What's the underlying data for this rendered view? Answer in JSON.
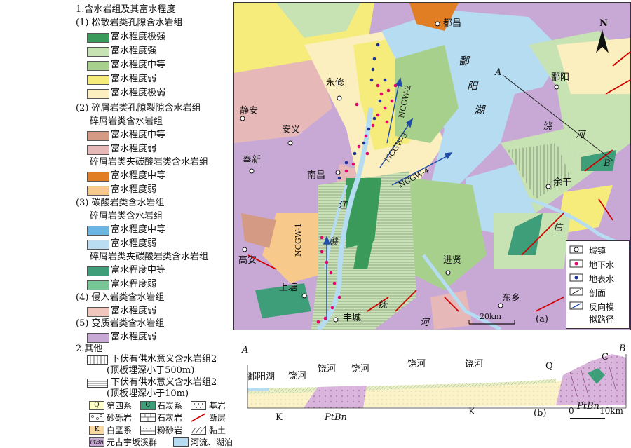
{
  "legend": {
    "h1": "1.含水岩组及其富水程度",
    "g1": "(1) 松散岩类孔隙含水岩组",
    "g1_items": [
      "富水程度极强",
      "富水程度强",
      "富水程度中等",
      "富水程度弱",
      "富水程度极弱"
    ],
    "g2": "(2) 碎屑岩类孔隙裂隙含水岩组",
    "g2a": "碎屑岩类含水岩组",
    "g2a_items": [
      "富水程度中等",
      "富水程度弱"
    ],
    "g2b": "碎屑岩类夹碳酸岩类含水岩组",
    "g2b_items": [
      "富水程度中等",
      "富水程度弱"
    ],
    "g3": "(3) 碳酸岩类含水岩组",
    "g3a": "碎屑岩类含水岩组",
    "g3a_items": [
      "富水程度中等",
      "富水程度弱"
    ],
    "g3b": "碎屑岩类夹碳酸岩类含水岩组",
    "g3b_items": [
      "富水程度中等",
      "富水程度弱"
    ],
    "g4": "(4) 侵入岩类含水岩组",
    "g4_items": [
      "富水程度弱"
    ],
    "g5": "(5) 变质岩类含水岩组",
    "g5_items": [
      "富水程度弱"
    ],
    "h2": "2.其他",
    "o1a": "下伏有供水意义含水岩组2",
    "o1b": "(顶板埋深小于500m)",
    "o2a": "下伏有供水意义含水岩组2",
    "o2b": "(顶板埋深小于10m)",
    "row1": {
      "q_sym": "Q",
      "q": "第四系",
      "c_sym": "C",
      "c": "石炭系",
      "bedrock": "基岩"
    },
    "row2": {
      "a": "砂砾岩",
      "b": "石灰岩",
      "c": "断层"
    },
    "row3": {
      "k_sym": "K",
      "k": "白垩系",
      "b": "粉砂岩",
      "c": "黏土"
    },
    "row4": {
      "pt_sym": "PtBn",
      "pt": "元古宇坂溪群",
      "river": "河流、湖泊"
    }
  },
  "colors": {
    "v_strong": "#3a9a5a",
    "strong": "#c7e3b3",
    "medium": "#a8d08d",
    "weak": "#f6ec7c",
    "v_weak": "#fbefc0",
    "clastic_med": "#d49a84",
    "clastic_weak": "#e6b8b8",
    "cc_med": "#e17d22",
    "cc_weak": "#f7c98b",
    "carb_med": "#6fb4de",
    "carb_weak": "#b9ddf1",
    "carb2_med": "#3f9e7a",
    "carb2_weak": "#7ac596",
    "intrusive": "#f1c7bd",
    "meta": "#c8a9d6",
    "lake": "#b6dcf2"
  },
  "map": {
    "cities": [
      "都昌",
      "鄱阳",
      "永修",
      "静安",
      "安义",
      "奉新",
      "南昌",
      "余干",
      "高安",
      "进贤",
      "上塘",
      "东乡",
      "丰城"
    ],
    "lake_label": [
      "鄱",
      "阳",
      "湖"
    ],
    "rivers": {
      "raohe": [
        "饶",
        "河"
      ],
      "xinjiang": [
        "信",
        "江"
      ],
      "ganjiang": [
        "江",
        "赣"
      ],
      "fuhe": [
        "抚",
        "河"
      ]
    },
    "profile_ends": {
      "a": "A",
      "b": "B"
    },
    "paths": [
      "NCGW-1",
      "NCGW-2",
      "NCGW-3",
      "NCGW-4"
    ],
    "north": "N",
    "scale": "20km",
    "panel": "(a)",
    "inner_legend": [
      "城镇",
      "地下水",
      "地表水",
      "剖面",
      "反向模",
      "拟路径"
    ]
  },
  "section": {
    "a": "A",
    "b": "B",
    "labels": [
      "鄱阳湖",
      "饶河",
      "饶河",
      "饶河",
      "饶河",
      "饶河"
    ],
    "q": "Q",
    "c": "C",
    "k1": "K",
    "k2": "K",
    "pt1": "PtBn",
    "pt2": "PtBn",
    "panel": "(b)",
    "scale0": "0",
    "scale10": "10km"
  }
}
